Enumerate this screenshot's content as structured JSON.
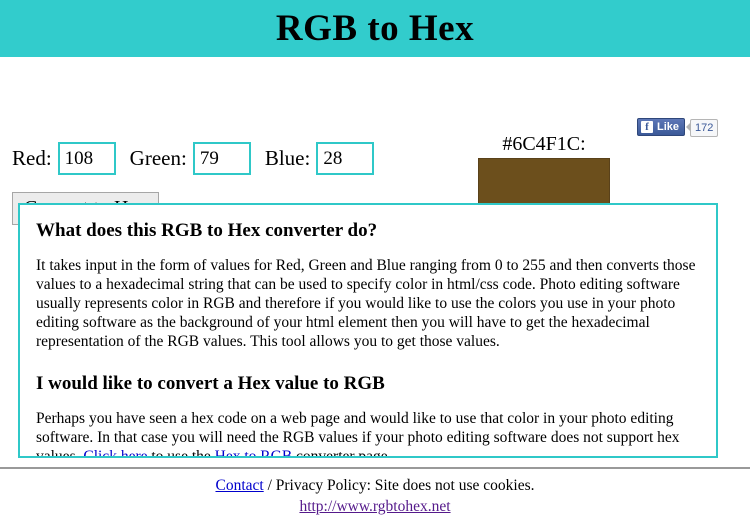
{
  "header": {
    "title": "RGB to Hex",
    "background_color": "#32CCCC"
  },
  "social": {
    "facebook_icon": "facebook-f-icon",
    "like_label": "Like",
    "like_count": "172"
  },
  "converter": {
    "red": {
      "label": "Red:",
      "value": "108"
    },
    "green": {
      "label": "Green:",
      "value": "79"
    },
    "blue": {
      "label": "Blue:",
      "value": "28"
    },
    "submit_label": "Convert to Hex",
    "result": {
      "hex_label": "#6C4F1C:",
      "swatch_color": "#6C4F1C"
    },
    "input_border_color": "#2FC8C8"
  },
  "info": {
    "heading_1": "What does this RGB to Hex converter do?",
    "paragraph_1": "It takes input in the form of values for Red, Green and Blue ranging from 0 to 255 and then converts those values to a hexadecimal string that can be used to specify color in html/css code. Photo editing software usually represents color in RGB and therefore if you would like to use the colors you use in your photo editing software as the background of your html element then you will have to get the hexadecimal representation of the RGB values. This tool allows you to get those values.",
    "heading_2": "I would like to convert a Hex value to RGB",
    "paragraph_2_part_1": "Perhaps you have seen a hex code on a web page and would like to use that color in your photo editing software. In that case you will need the RGB values if your photo editing software does not support hex values. ",
    "link_click_here": "Click here",
    "paragraph_2_part_2": " to use the ",
    "link_hex_to_rgb": "Hex to RGB",
    "paragraph_2_part_3": " converter page."
  },
  "footer": {
    "contact_link": "Contact",
    "privacy_text": " / Privacy Policy: Site does not use cookies.",
    "site_url": "http://www.rgbtohex.net"
  }
}
